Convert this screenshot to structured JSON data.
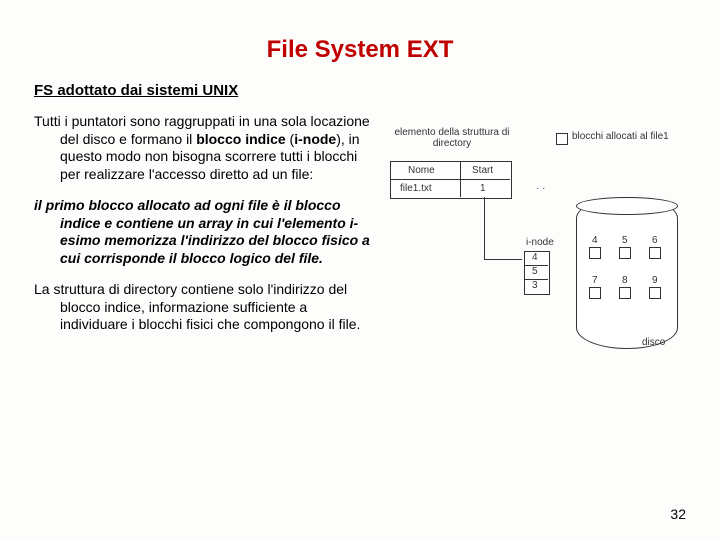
{
  "title": "File System EXT",
  "subtitle": "FS adottato dai sistemi UNIX",
  "para1": "Tutti i puntatori sono raggruppati in una sola locazione del disco e formano il blocco indice (i-node), in questo modo non bisogna scorrere tutti i blocchi per realizzare l'accesso diretto ad un file:",
  "para2": "il primo blocco allocato ad ogni file è il blocco indice e contiene un array in cui l'elemento i-esimo memorizza l'indirizzo del blocco fisico a cui corrisponde il blocco logico del file.",
  "para3": "La struttura di directory contiene solo l'indirizzo del blocco indice, informazione sufficiente a individuare i blocchi fisici che compongono il file.",
  "diagram": {
    "dir_label": "elemento della struttura di directory",
    "blocks_label": "blocchi allocati al file1",
    "col_name": "Nome",
    "col_start": "Start",
    "file_name": "file1.txt",
    "file_start": "1",
    "inode_label": "i-node",
    "inode_rows": [
      "4",
      "5",
      "3"
    ],
    "blocks": [
      "4",
      "5",
      "6",
      "7",
      "8",
      "9"
    ],
    "disk_label": "disco"
  },
  "page_number": "32"
}
